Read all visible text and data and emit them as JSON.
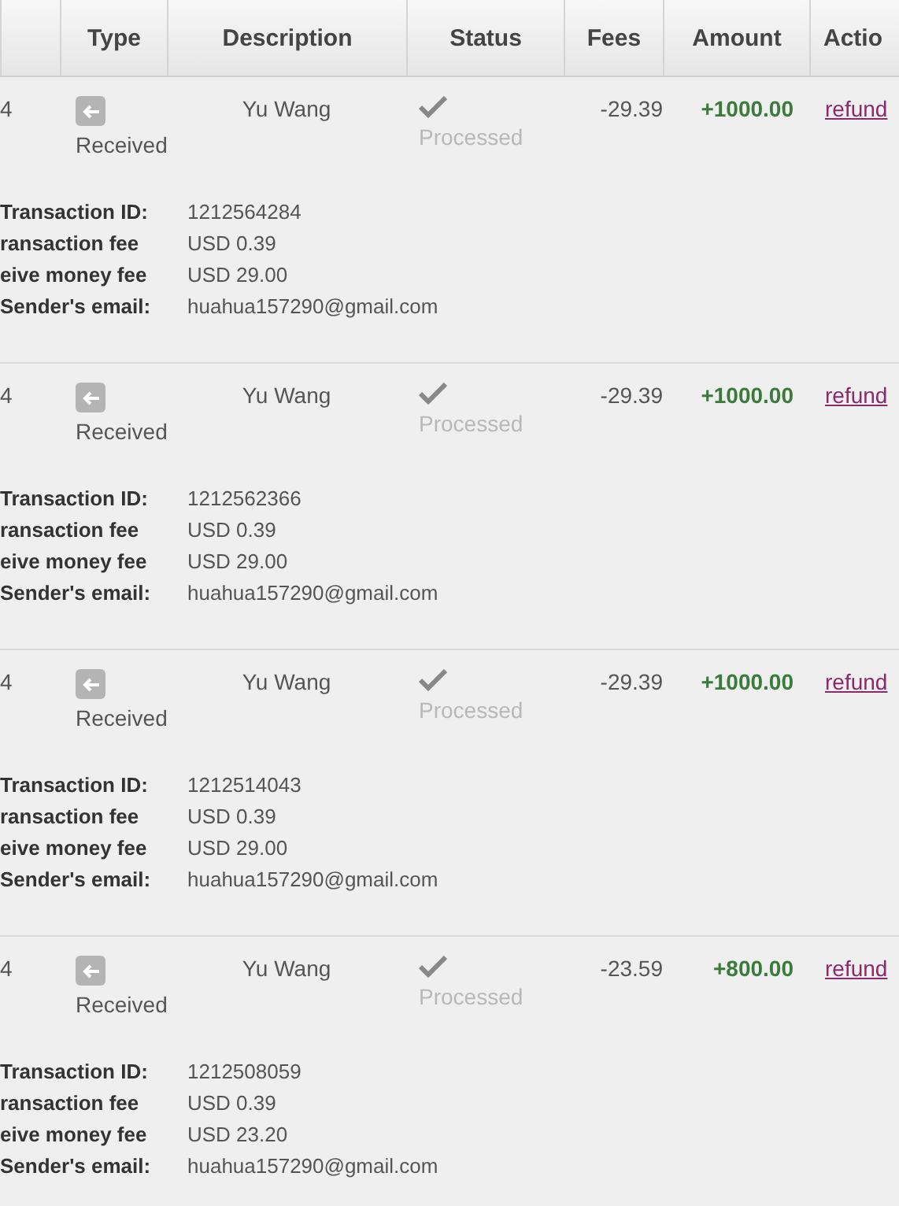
{
  "table": {
    "columns": [
      "",
      "Type",
      "Description",
      "Status",
      "Fees",
      "Amount",
      "Actio"
    ],
    "rows": [
      {
        "column_1": "4",
        "type": "Received",
        "description": "Yu Wang",
        "status": "Processed",
        "fees": "-29.39",
        "amount": "+1000.00",
        "action": "refund",
        "details": [
          {
            "label": "Transaction ID:",
            "value": "1212564284"
          },
          {
            "label": "ransaction fee",
            "value": "USD 0.39"
          },
          {
            "label": "eive money fee",
            "value": "USD 29.00"
          },
          {
            "label": "Sender's email:",
            "value": "huahua157290@gmail.com"
          }
        ]
      },
      {
        "column_1": "4",
        "type": "Received",
        "description": "Yu Wang",
        "status": "Processed",
        "fees": "-29.39",
        "amount": "+1000.00",
        "action": "refund",
        "details": [
          {
            "label": "Transaction ID:",
            "value": "1212562366"
          },
          {
            "label": "ransaction fee",
            "value": "USD 0.39"
          },
          {
            "label": "eive money fee",
            "value": "USD 29.00"
          },
          {
            "label": "Sender's email:",
            "value": "huahua157290@gmail.com"
          }
        ]
      },
      {
        "column_1": "4",
        "type": "Received",
        "description": "Yu Wang",
        "status": "Processed",
        "fees": "-29.39",
        "amount": "+1000.00",
        "action": "refund",
        "details": [
          {
            "label": "Transaction ID:",
            "value": "1212514043"
          },
          {
            "label": "ransaction fee",
            "value": "USD 0.39"
          },
          {
            "label": "eive money fee",
            "value": "USD 29.00"
          },
          {
            "label": "Sender's email:",
            "value": "huahua157290@gmail.com"
          }
        ]
      },
      {
        "column_1": "4",
        "type": "Received",
        "description": "Yu Wang",
        "status": "Processed",
        "fees": "-23.59",
        "amount": "+800.00",
        "action": "refund",
        "details": [
          {
            "label": "Transaction ID:",
            "value": "1212508059"
          },
          {
            "label": "ransaction fee",
            "value": "USD 0.39"
          },
          {
            "label": "eive money fee",
            "value": "USD 23.20"
          },
          {
            "label": "Sender's email:",
            "value": "huahua157290@gmail.com"
          }
        ]
      }
    ]
  }
}
